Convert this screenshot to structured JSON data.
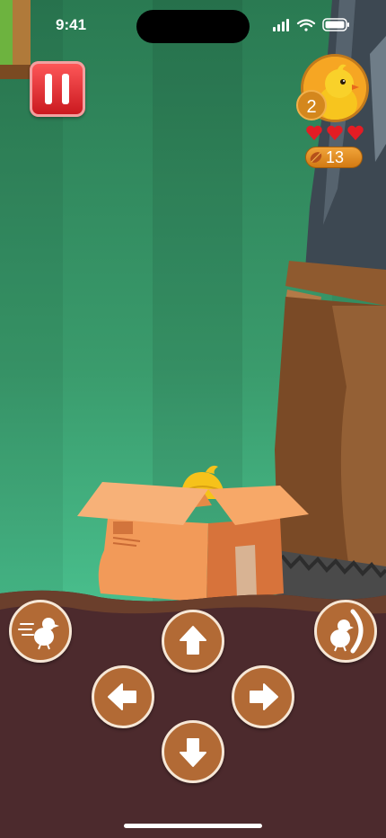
{
  "status_bar": {
    "time": "9:41",
    "icons": [
      "cellular-signal-icon",
      "wifi-icon",
      "battery-icon"
    ]
  },
  "hud": {
    "pause_icon": "pause-icon",
    "level": "2",
    "hearts": {
      "filled": 3,
      "total": 3,
      "color": "#e41c24"
    },
    "seeds": "13"
  },
  "scene": {
    "objects": [
      "corner-platform",
      "giant-boot",
      "cardboard-box",
      "hiding-chick"
    ]
  },
  "controls": {
    "dash_icon": "dash-chick-icon",
    "up_icon": "arrow-up-icon",
    "left_icon": "arrow-left-icon",
    "right_icon": "arrow-right-icon",
    "down_icon": "arrow-down-icon",
    "shield_icon": "shield-chick-icon"
  },
  "colors": {
    "background_green": "#3a9b6c",
    "ground_dirt": "#4c2a2d",
    "control_brown": "#b26a35",
    "pause_red": "#d8242a"
  }
}
